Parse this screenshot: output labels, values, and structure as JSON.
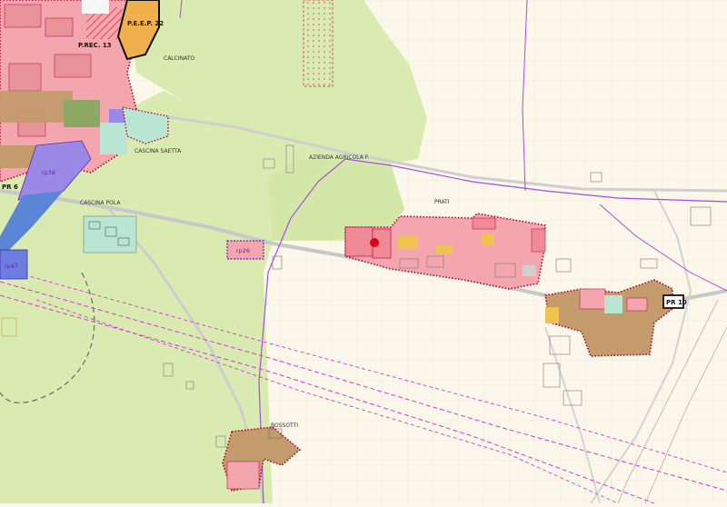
{
  "map": {
    "colors": {
      "background": "#fbf7ea",
      "agricultural": "#d9ebb0",
      "residential": "#f3a6ad",
      "residential_line": "#c2185b",
      "boundary_dotted": "#b0002a",
      "industrial": "#c39b6d",
      "service_blue": "#5b86d6",
      "service_violet": "#9a8ae6",
      "green_area": "#b9e6d3",
      "purple_line": "#a64ee0",
      "magenta_dashed": "#d23ad6",
      "road": "#c8c8c8",
      "point_marker": "#e0001b"
    },
    "place_labels": {
      "calcinato": "CALCINATO",
      "cascina_saetta": "CASCINA SAETTA",
      "azienda_agricola": "AZIENDA AGRICOLA F.",
      "cascina_pola": "CASCINA POLA",
      "prati": "PRATI",
      "bossotti": "BOSSOTTI"
    },
    "zone_codes": {
      "peep": "P.E.E.P. 22",
      "prec": "P.REC. 13",
      "pr6": "PR 6",
      "pr10": "PR 10",
      "rp38": "rp38",
      "rp47": "rp47",
      "rp26": "rp26"
    }
  }
}
